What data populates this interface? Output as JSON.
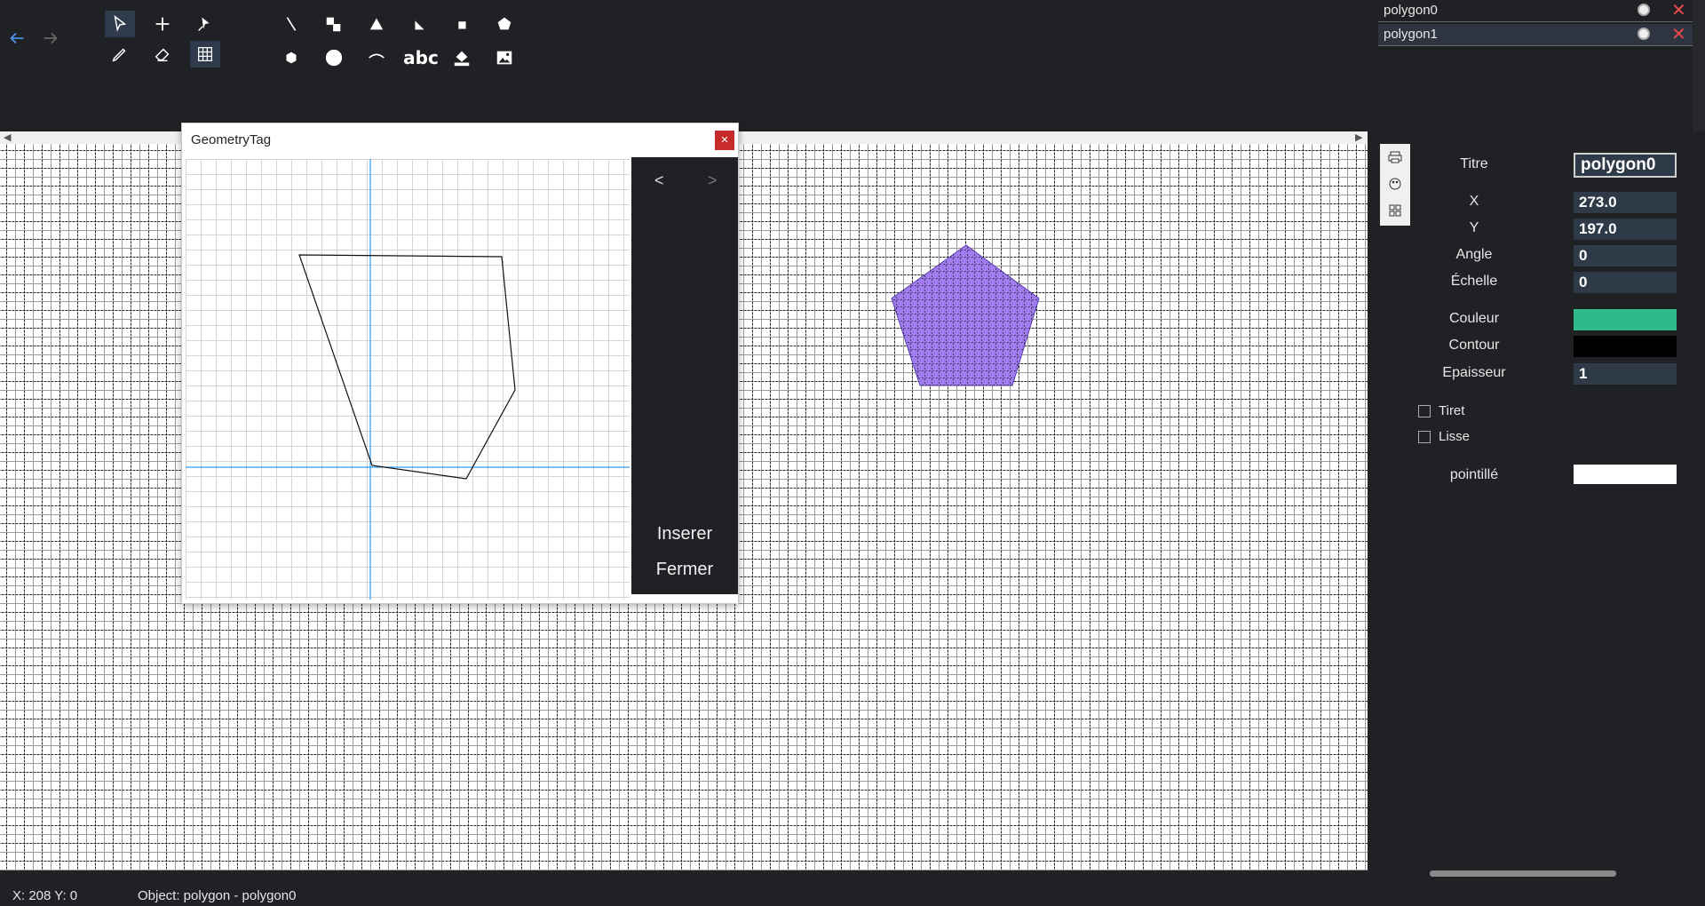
{
  "nav": {
    "back_icon": "arrow-left-icon",
    "forward_icon": "arrow-right-icon"
  },
  "tools": [
    {
      "name": "select-tool",
      "icon": "cursor-icon",
      "active": true
    },
    {
      "name": "add-point-tool",
      "icon": "plus-icon"
    },
    {
      "name": "vertex-edit-tool",
      "icon": "vertex-cursor-icon"
    },
    {
      "name": "pencil-tool",
      "icon": "pencil-icon"
    },
    {
      "name": "eraser-tool",
      "icon": "eraser-icon"
    },
    {
      "name": "grid-tool",
      "icon": "grid-icon",
      "active": true
    },
    {
      "name": "line-tool",
      "icon": "line-icon"
    },
    {
      "name": "rect-link-tool",
      "icon": "squares-icon"
    },
    {
      "name": "triangle-tool",
      "icon": "triangle-icon"
    },
    {
      "name": "right-triangle-tool",
      "icon": "right-triangle-icon"
    },
    {
      "name": "square-tool",
      "icon": "square-icon"
    },
    {
      "name": "pentagon-tool",
      "icon": "pentagon-icon"
    },
    {
      "name": "hexagon-tool",
      "icon": "hexagon-icon"
    },
    {
      "name": "circle-tool",
      "icon": "circle-icon"
    },
    {
      "name": "arc-tool",
      "icon": "arc-icon"
    },
    {
      "name": "text-tool",
      "icon": "text-icon",
      "label": "abc"
    },
    {
      "name": "fill-tool",
      "icon": "paint-bucket-icon"
    },
    {
      "name": "image-tool",
      "icon": "image-icon"
    }
  ],
  "layers": [
    {
      "name": "polygon0",
      "selected": false
    },
    {
      "name": "polygon1",
      "selected": true
    }
  ],
  "dialog": {
    "title": "GeometryTag",
    "close": "×",
    "prev": "<",
    "next": ">",
    "insert_label": "Inserer",
    "close_label": "Fermer"
  },
  "properties": {
    "titre_label": "Titre",
    "titre_value": "polygon0",
    "x_label": "X",
    "x_value": "273.0",
    "y_label": "Y",
    "y_value": "197.0",
    "angle_label": "Angle",
    "angle_value": "0",
    "echelle_label": "Échelle",
    "echelle_value": "0",
    "couleur_label": "Couleur",
    "couleur_value": "#2fba8a",
    "contour_label": "Contour",
    "contour_value": "#000000",
    "epaisseur_label": "Epaisseur",
    "epaisseur_value": "1",
    "tiret_label": "Tiret",
    "lisse_label": "Lisse",
    "pointille_label": "pointillé",
    "pointille_value": ""
  },
  "shape": {
    "fill": "#a07cf0",
    "stroke": "#5a3fb0"
  },
  "status": {
    "coords": "X: 208  Y: 0",
    "object": "Object: polygon - polygon0"
  }
}
